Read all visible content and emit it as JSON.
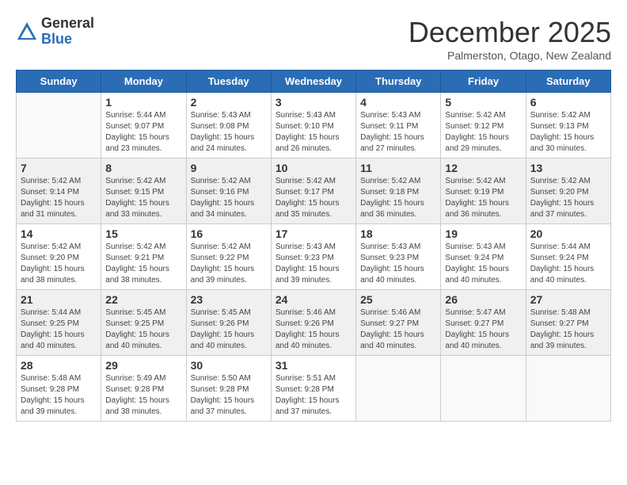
{
  "logo": {
    "general": "General",
    "blue": "Blue"
  },
  "title": "December 2025",
  "subtitle": "Palmerston, Otago, New Zealand",
  "days_of_week": [
    "Sunday",
    "Monday",
    "Tuesday",
    "Wednesday",
    "Thursday",
    "Friday",
    "Saturday"
  ],
  "weeks": [
    [
      {
        "day": "",
        "info": ""
      },
      {
        "day": "1",
        "info": "Sunrise: 5:44 AM\nSunset: 9:07 PM\nDaylight: 15 hours\nand 23 minutes."
      },
      {
        "day": "2",
        "info": "Sunrise: 5:43 AM\nSunset: 9:08 PM\nDaylight: 15 hours\nand 24 minutes."
      },
      {
        "day": "3",
        "info": "Sunrise: 5:43 AM\nSunset: 9:10 PM\nDaylight: 15 hours\nand 26 minutes."
      },
      {
        "day": "4",
        "info": "Sunrise: 5:43 AM\nSunset: 9:11 PM\nDaylight: 15 hours\nand 27 minutes."
      },
      {
        "day": "5",
        "info": "Sunrise: 5:42 AM\nSunset: 9:12 PM\nDaylight: 15 hours\nand 29 minutes."
      },
      {
        "day": "6",
        "info": "Sunrise: 5:42 AM\nSunset: 9:13 PM\nDaylight: 15 hours\nand 30 minutes."
      }
    ],
    [
      {
        "day": "7",
        "info": "Sunrise: 5:42 AM\nSunset: 9:14 PM\nDaylight: 15 hours\nand 31 minutes."
      },
      {
        "day": "8",
        "info": "Sunrise: 5:42 AM\nSunset: 9:15 PM\nDaylight: 15 hours\nand 33 minutes."
      },
      {
        "day": "9",
        "info": "Sunrise: 5:42 AM\nSunset: 9:16 PM\nDaylight: 15 hours\nand 34 minutes."
      },
      {
        "day": "10",
        "info": "Sunrise: 5:42 AM\nSunset: 9:17 PM\nDaylight: 15 hours\nand 35 minutes."
      },
      {
        "day": "11",
        "info": "Sunrise: 5:42 AM\nSunset: 9:18 PM\nDaylight: 15 hours\nand 36 minutes."
      },
      {
        "day": "12",
        "info": "Sunrise: 5:42 AM\nSunset: 9:19 PM\nDaylight: 15 hours\nand 36 minutes."
      },
      {
        "day": "13",
        "info": "Sunrise: 5:42 AM\nSunset: 9:20 PM\nDaylight: 15 hours\nand 37 minutes."
      }
    ],
    [
      {
        "day": "14",
        "info": "Sunrise: 5:42 AM\nSunset: 9:20 PM\nDaylight: 15 hours\nand 38 minutes."
      },
      {
        "day": "15",
        "info": "Sunrise: 5:42 AM\nSunset: 9:21 PM\nDaylight: 15 hours\nand 38 minutes."
      },
      {
        "day": "16",
        "info": "Sunrise: 5:42 AM\nSunset: 9:22 PM\nDaylight: 15 hours\nand 39 minutes."
      },
      {
        "day": "17",
        "info": "Sunrise: 5:43 AM\nSunset: 9:23 PM\nDaylight: 15 hours\nand 39 minutes."
      },
      {
        "day": "18",
        "info": "Sunrise: 5:43 AM\nSunset: 9:23 PM\nDaylight: 15 hours\nand 40 minutes."
      },
      {
        "day": "19",
        "info": "Sunrise: 5:43 AM\nSunset: 9:24 PM\nDaylight: 15 hours\nand 40 minutes."
      },
      {
        "day": "20",
        "info": "Sunrise: 5:44 AM\nSunset: 9:24 PM\nDaylight: 15 hours\nand 40 minutes."
      }
    ],
    [
      {
        "day": "21",
        "info": "Sunrise: 5:44 AM\nSunset: 9:25 PM\nDaylight: 15 hours\nand 40 minutes."
      },
      {
        "day": "22",
        "info": "Sunrise: 5:45 AM\nSunset: 9:25 PM\nDaylight: 15 hours\nand 40 minutes."
      },
      {
        "day": "23",
        "info": "Sunrise: 5:45 AM\nSunset: 9:26 PM\nDaylight: 15 hours\nand 40 minutes."
      },
      {
        "day": "24",
        "info": "Sunrise: 5:46 AM\nSunset: 9:26 PM\nDaylight: 15 hours\nand 40 minutes."
      },
      {
        "day": "25",
        "info": "Sunrise: 5:46 AM\nSunset: 9:27 PM\nDaylight: 15 hours\nand 40 minutes."
      },
      {
        "day": "26",
        "info": "Sunrise: 5:47 AM\nSunset: 9:27 PM\nDaylight: 15 hours\nand 40 minutes."
      },
      {
        "day": "27",
        "info": "Sunrise: 5:48 AM\nSunset: 9:27 PM\nDaylight: 15 hours\nand 39 minutes."
      }
    ],
    [
      {
        "day": "28",
        "info": "Sunrise: 5:48 AM\nSunset: 9:28 PM\nDaylight: 15 hours\nand 39 minutes."
      },
      {
        "day": "29",
        "info": "Sunrise: 5:49 AM\nSunset: 9:28 PM\nDaylight: 15 hours\nand 38 minutes."
      },
      {
        "day": "30",
        "info": "Sunrise: 5:50 AM\nSunset: 9:28 PM\nDaylight: 15 hours\nand 37 minutes."
      },
      {
        "day": "31",
        "info": "Sunrise: 5:51 AM\nSunset: 9:28 PM\nDaylight: 15 hours\nand 37 minutes."
      },
      {
        "day": "",
        "info": ""
      },
      {
        "day": "",
        "info": ""
      },
      {
        "day": "",
        "info": ""
      }
    ]
  ],
  "row_shading": [
    false,
    true,
    false,
    true,
    false
  ]
}
